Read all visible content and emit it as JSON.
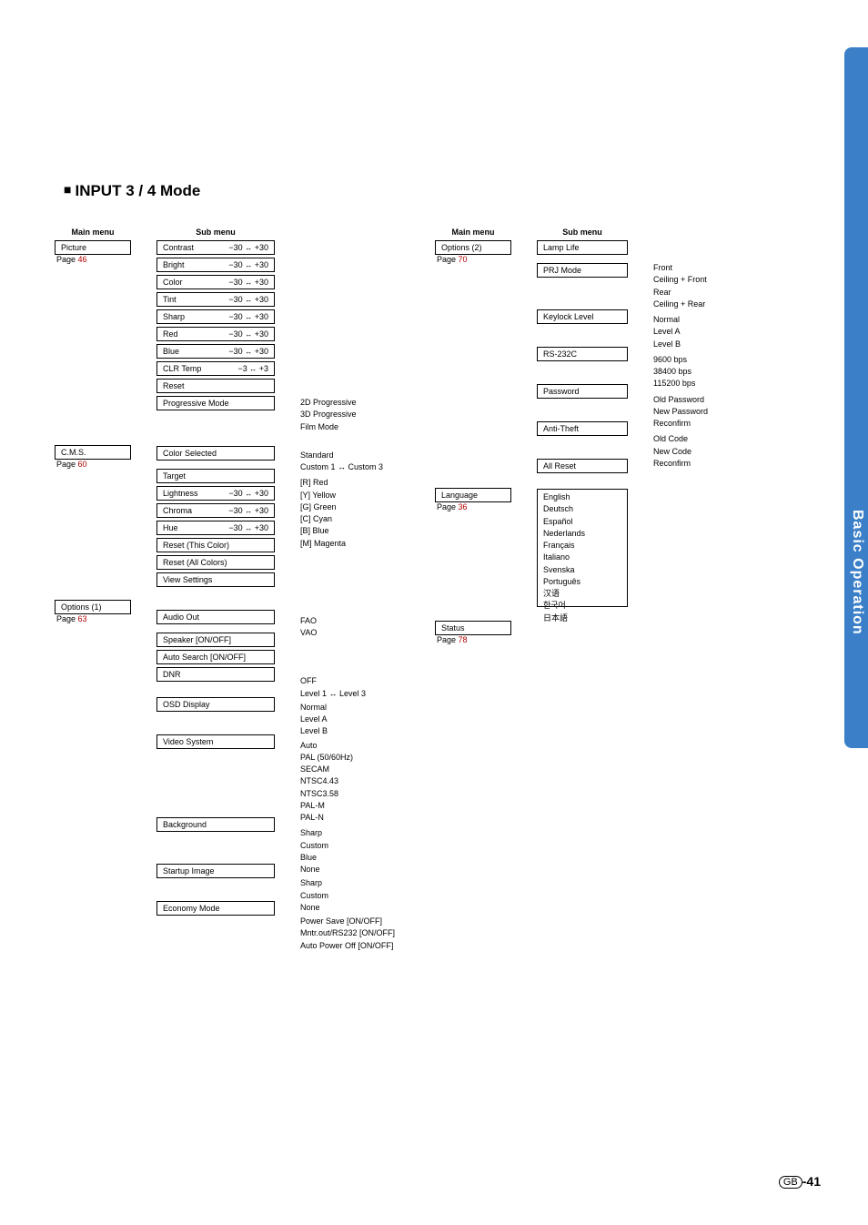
{
  "title": "INPUT 3 / 4 Mode",
  "labels": {
    "mainmenu": "Main menu",
    "submenu": "Sub menu"
  },
  "left": {
    "picture": {
      "name": "Picture",
      "page": "46"
    },
    "cms": {
      "name": "C.M.S.",
      "page": "60"
    },
    "options1": {
      "name": "Options (1)",
      "page": "63"
    }
  },
  "pictureSub": {
    "contrast": {
      "label": "Contrast",
      "lo": "−30",
      "hi": "+30"
    },
    "bright": {
      "label": "Bright",
      "lo": "−30",
      "hi": "+30"
    },
    "color": {
      "label": "Color",
      "lo": "−30",
      "hi": "+30"
    },
    "tint": {
      "label": "Tint",
      "lo": "−30",
      "hi": "+30"
    },
    "sharp": {
      "label": "Sharp",
      "lo": "−30",
      "hi": "+30"
    },
    "red": {
      "label": "Red",
      "lo": "−30",
      "hi": "+30"
    },
    "blue": {
      "label": "Blue",
      "lo": "−30",
      "hi": "+30"
    },
    "clrtemp": {
      "label": "CLR Temp",
      "lo": "−3",
      "hi": "+3"
    },
    "reset": "Reset",
    "progressive": "Progressive Mode"
  },
  "progressiveOpts": {
    "a": "2D Progressive",
    "b": "3D Progressive",
    "c": "Film Mode"
  },
  "cmsSub": {
    "colorSelected": "Color Selected",
    "target": "Target",
    "lightness": {
      "label": "Lightness",
      "lo": "−30",
      "hi": "+30"
    },
    "chroma": {
      "label": "Chroma",
      "lo": "−30",
      "hi": "+30"
    },
    "hue": {
      "label": "Hue",
      "lo": "−30",
      "hi": "+30"
    },
    "resetThis": "Reset (This Color)",
    "resetAll": "Reset (All Colors)",
    "view": "View Settings"
  },
  "colorSelOpts": {
    "a": "Standard",
    "b": "Custom 1 ↔ Custom 3"
  },
  "targetOpts": {
    "r": "[R] Red",
    "y": "[Y] Yellow",
    "g": "[G] Green",
    "c": "[C] Cyan",
    "b": "[B] Blue",
    "m": "[M] Magenta"
  },
  "opt1Sub": {
    "audioOut": "Audio Out",
    "speaker": "Speaker [ON/OFF]",
    "autoSearch": "Auto Search [ON/OFF]",
    "dnr": "DNR",
    "osd": "OSD Display",
    "video": "Video System",
    "background": "Background",
    "startup": "Startup Image",
    "economy": "Economy Mode"
  },
  "audioOutOpts": {
    "a": "FAO",
    "b": "VAO"
  },
  "dnrOpts": {
    "a": "OFF",
    "b": "Level 1 ↔ Level 3"
  },
  "osdOpts": {
    "a": "Normal",
    "b": "Level A",
    "c": "Level B"
  },
  "videoOpts": {
    "a": "Auto",
    "b": "PAL (50/60Hz)",
    "c": "SECAM",
    "d": "NTSC4.43",
    "e": "NTSC3.58",
    "f": "PAL-M",
    "g": "PAL-N"
  },
  "bgOpts": {
    "a": "Sharp",
    "b": "Custom",
    "c": "Blue",
    "d": "None"
  },
  "startupOpts": {
    "a": "Sharp",
    "b": "Custom",
    "c": "None"
  },
  "economyOpts": {
    "a": "Power Save [ON/OFF]",
    "b": "Mntr.out/RS232 [ON/OFF]",
    "c": "Auto Power Off [ON/OFF]"
  },
  "right": {
    "options2": {
      "name": "Options (2)",
      "page": "70"
    },
    "language": {
      "name": "Language",
      "page": "36"
    },
    "status": {
      "name": "Status",
      "page": "78"
    }
  },
  "opt2Sub": {
    "lampLife": "Lamp Life",
    "prj": "PRJ Mode",
    "keylock": "Keylock Level",
    "rs232": "RS-232C",
    "password": "Password",
    "antiTheft": "Anti-Theft",
    "allReset": "All Reset"
  },
  "prjOpts": {
    "a": "Front",
    "b": "Ceiling + Front",
    "c": "Rear",
    "d": "Ceiling + Rear"
  },
  "keylockOpts": {
    "a": "Normal",
    "b": "Level A",
    "c": "Level B"
  },
  "rs232Opts": {
    "a": "9600 bps",
    "b": "38400 bps",
    "c": "115200 bps"
  },
  "passwordOpts": {
    "a": "Old Password",
    "b": "New Password",
    "c": "Reconfirm"
  },
  "antiTheftOpts": {
    "a": "Old Code",
    "b": "New Code",
    "c": "Reconfirm"
  },
  "langOpts": {
    "a": "English",
    "b": "Deutsch",
    "c": "Español",
    "d": "Nederlands",
    "e": "Français",
    "f": "Italiano",
    "g": "Svenska",
    "h": "Português",
    "i": "汉语",
    "j": "한국어",
    "k": "日本語"
  },
  "sidebar": "Basic Operation",
  "footer": {
    "gb": "GB",
    "page": "-41"
  }
}
